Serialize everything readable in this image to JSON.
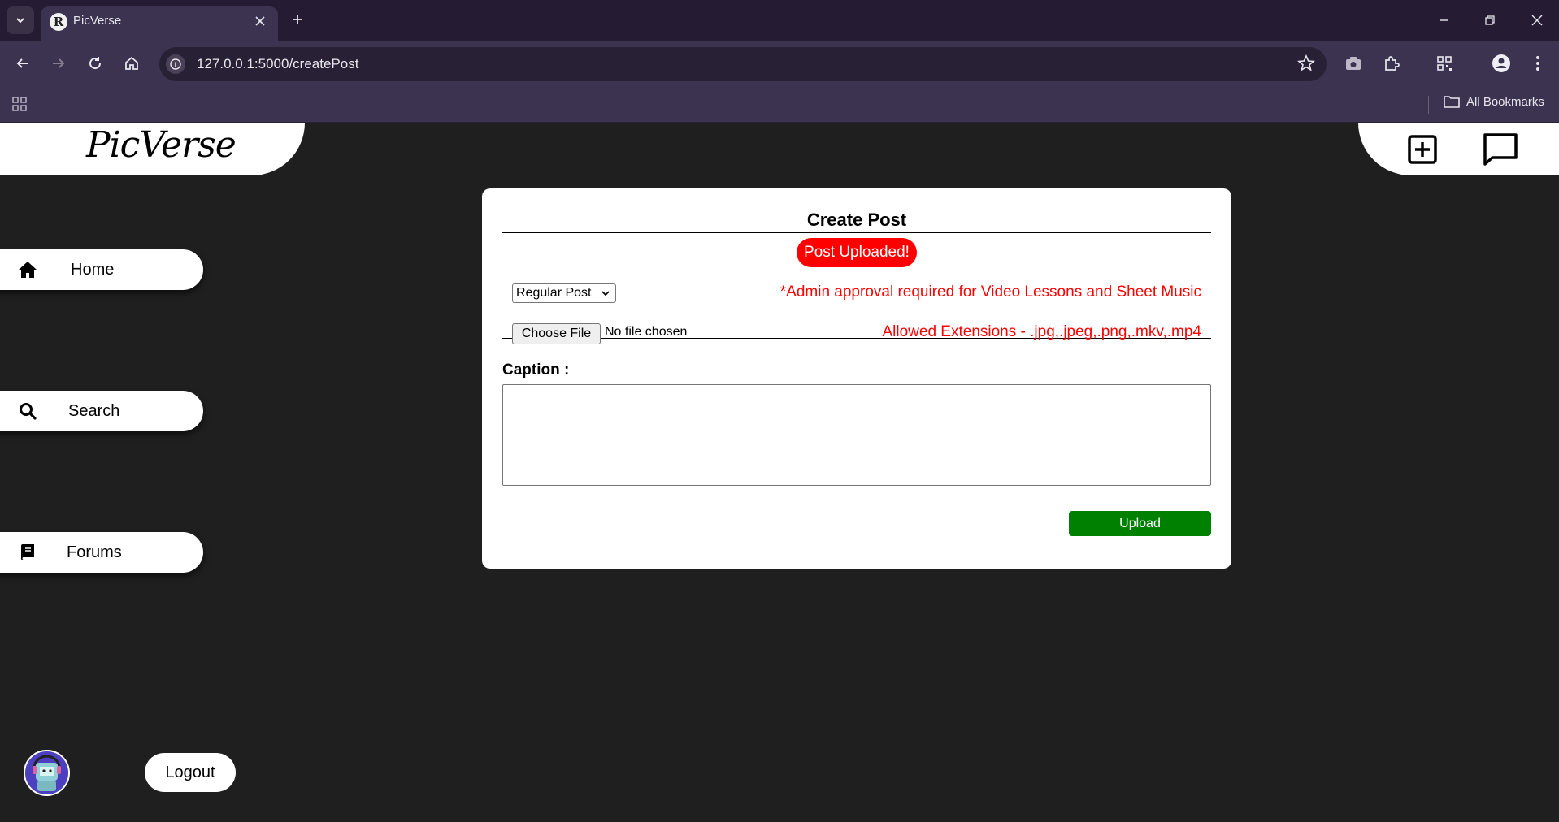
{
  "browser": {
    "tab_title": "PicVerse",
    "url": "127.0.0.1:5000/createPost",
    "bookmarks_label": "All Bookmarks"
  },
  "app": {
    "logo": "PicVerse"
  },
  "nav": {
    "home": "Home",
    "search": "Search",
    "forums": "Forums",
    "logout": "Logout"
  },
  "form": {
    "title": "Create Post",
    "flash_message": "Post Uploaded!",
    "post_type_selected": "Regular Post",
    "admin_note": "*Admin approval required for Video Lessons and Sheet Music",
    "choose_file_label": "Choose File",
    "file_status": "No file chosen",
    "allowed_extensions": "Allowed Extensions - .jpg,.jpeg,.png,.mkv,.mp4",
    "caption_label": "Caption :",
    "caption_value": "",
    "upload_label": "Upload"
  },
  "colors": {
    "accent_red": "#ff0000",
    "upload_green": "#008000",
    "page_bg": "#1f1f1f"
  }
}
